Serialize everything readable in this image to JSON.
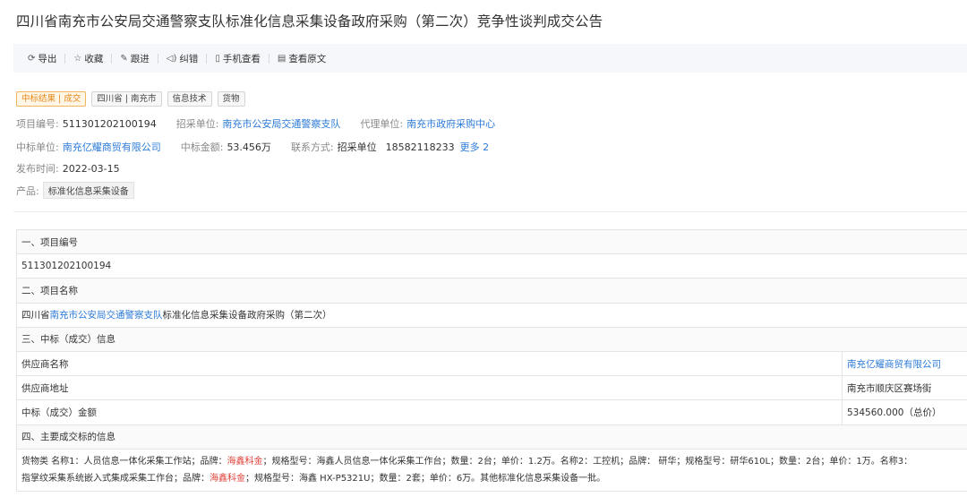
{
  "title": "四川省南充市公安局交通警察支队标准化信息采集设备政府采购（第二次）竞争性谈判成交公告",
  "toolbar": [
    {
      "icon": "export-icon",
      "glyph": "⟳",
      "label": "导出"
    },
    {
      "icon": "star-icon",
      "glyph": "☆",
      "label": "收藏"
    },
    {
      "icon": "pen-icon",
      "glyph": "✎",
      "label": "跟进"
    },
    {
      "icon": "speaker-icon",
      "glyph": "◁)",
      "label": "纠错"
    },
    {
      "icon": "phone-icon",
      "glyph": "▯",
      "label": "手机查看"
    },
    {
      "icon": "document-icon",
      "glyph": "▤",
      "label": "查看原文"
    }
  ],
  "tags": [
    "中标结果 | 成交",
    "四川省 | 南充市",
    "信息技术",
    "货物"
  ],
  "meta": {
    "project_no_label": "项目编号:",
    "project_no": "511301202100194",
    "buyer_label": "招采单位:",
    "buyer": "南充市公安局交通警察支队",
    "agent_label": "代理单位:",
    "agent": "南充市政府采购中心",
    "winner_label": "中标单位:",
    "winner": "南充亿耀商贸有限公司",
    "amount_label": "中标金额:",
    "amount": "53.456万",
    "contact_label": "联系方式:",
    "contact_unit": "招采单位",
    "contact_phone": "18582118233",
    "more": "更多 2",
    "publish_label": "发布时间:",
    "publish_date": "2022-03-15",
    "product_label": "产品:",
    "product": "标准化信息采集设备"
  },
  "table": {
    "s1": "一、项目编号",
    "project_no": "511301202100194",
    "s2": "二、项目名称",
    "name_pre": "四川省",
    "name_link": "南充市公安局交通警察支队",
    "name_post": "标准化信息采集设备政府采购（第二次）",
    "s3": "三、中标（成交）信息",
    "supplier_name_label": "供应商名称",
    "supplier_name": "南充亿耀商贸有限公司",
    "supplier_addr_label": "供应商地址",
    "supplier_addr": "南充市顺庆区赛场街",
    "amount_label": "中标（成交）金额",
    "amount": "534560.000（总价）",
    "s4": "四、主要成交标的信息",
    "detail_a": "货物类 名称1：人员信息一体化采集工作站；品牌：",
    "brand1": "海鑫科金",
    "detail_b": "；规格型号：海鑫人员信息一体化采集工作台；数量：2台；单价：1.2万。名称2：工控机；品牌： 研华；规格型号：研华610L；数量：2台；单价：1万。名称3：",
    "detail_c": "指掌纹采集系统嵌入式集成采集工作台；品牌：",
    "brand2": "海鑫科金",
    "detail_d": "；规格型号：海鑫 HX-P5321U；数量：2套；单价：6万。其他标准化信息采集设备一批。"
  }
}
